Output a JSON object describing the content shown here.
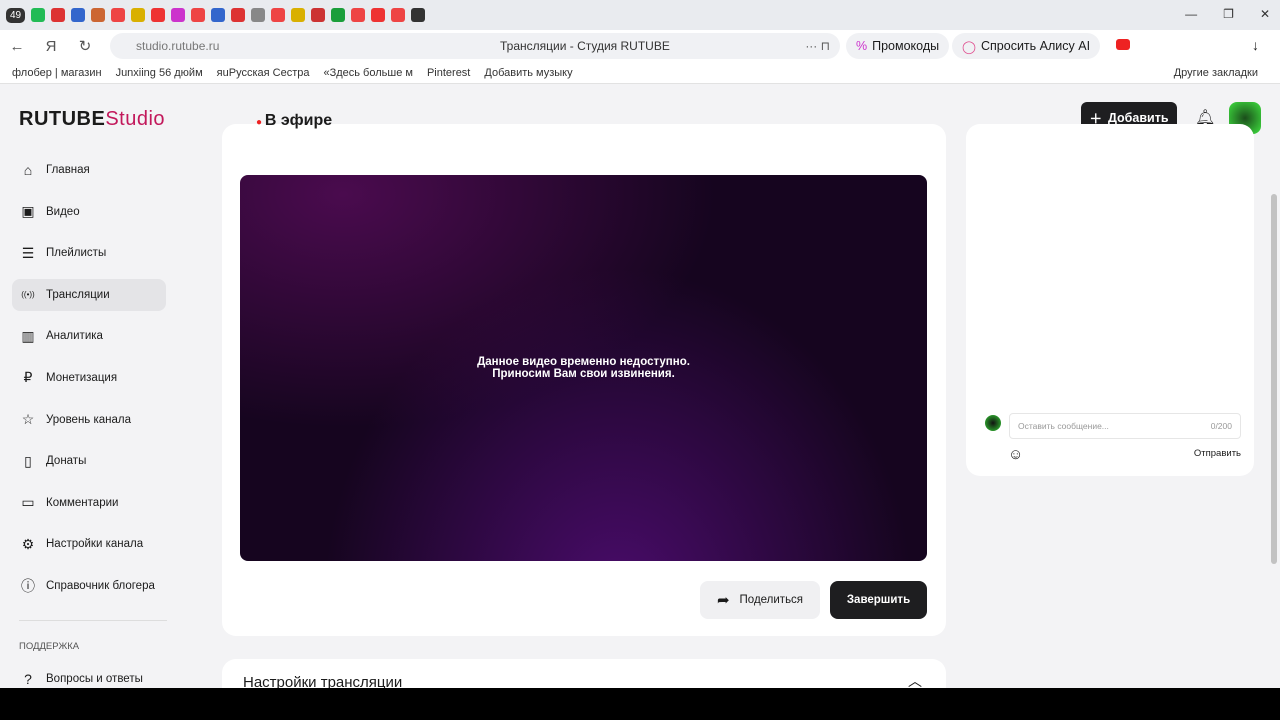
{
  "browser": {
    "tab_count": "49",
    "url": "studio.rutube.ru",
    "page_title": "Трансляции - Студия RUTUBE",
    "promo": "Промокоды",
    "alice": "Спросить Алису AI",
    "bookmarks": [
      "флобер | магазин",
      "Junxiing 56 дюйм",
      "яuРусская Сестра",
      "«Здесь больше м",
      "Pinterest",
      "Добавить музыку"
    ],
    "other_bookmarks": "Другие закладки"
  },
  "header": {
    "logo": "RUTUBE",
    "logo_studio": "Studio",
    "add": "Добавить"
  },
  "sidebar": {
    "items": [
      {
        "label": "Главная",
        "icon": "⌂"
      },
      {
        "label": "Видео",
        "icon": "▣"
      },
      {
        "label": "Плейлисты",
        "icon": "☰"
      },
      {
        "label": "Трансляции",
        "icon": "((•))"
      },
      {
        "label": "Аналитика",
        "icon": "▥"
      },
      {
        "label": "Монетизация",
        "icon": "₽"
      },
      {
        "label": "Уровень канала",
        "icon": "☆"
      },
      {
        "label": "Донаты",
        "icon": "▯"
      },
      {
        "label": "Комментарии",
        "icon": "▭"
      },
      {
        "label": "Настройки канала",
        "icon": "⚙"
      },
      {
        "label": "Справочник блогера",
        "icon": "ⓘ"
      }
    ],
    "support_heading": "ПОДДЕРЖКА",
    "faq": "Вопросы и ответы"
  },
  "stream": {
    "title": "В эфире",
    "message_line1": "Данное видео временно недоступно.",
    "message_line2": "Приносим Вам свои извинения.",
    "share": "Поделиться",
    "finish": "Завершить"
  },
  "chat": {
    "placeholder": "Оставить сообщение...",
    "counter": "0/200",
    "send": "Отправить"
  },
  "settings": {
    "title": "Настройки трансляции"
  }
}
